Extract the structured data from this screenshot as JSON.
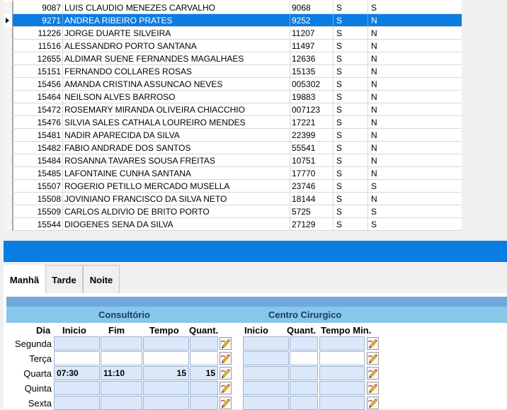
{
  "grid": {
    "rows": [
      {
        "id": "9087",
        "name": "LUIS CLAUDIO MENEZES CARVALHO",
        "code": "9068",
        "s1": "S",
        "s2": "S",
        "selected": false
      },
      {
        "id": "9271",
        "name": "ANDREA RIBEIRO PRATES",
        "code": "9252",
        "s1": "S",
        "s2": "N",
        "selected": true
      },
      {
        "id": "11226",
        "name": "JORGE DUARTE SILVEIRA",
        "code": "11207",
        "s1": "S",
        "s2": "N",
        "selected": false
      },
      {
        "id": "11516",
        "name": "ALESSANDRO PORTO SANTANA",
        "code": "11497",
        "s1": "S",
        "s2": "N",
        "selected": false
      },
      {
        "id": "12655",
        "name": "ALDIMAR SUENE FERNANDES MAGALHAES",
        "code": "12636",
        "s1": "S",
        "s2": "N",
        "selected": false
      },
      {
        "id": "15151",
        "name": "FERNANDO COLLARES ROSAS",
        "code": "15135",
        "s1": "S",
        "s2": "N",
        "selected": false
      },
      {
        "id": "15456",
        "name": "AMANDA CRISTINA ASSUNCAO NEVES",
        "code": "005302",
        "s1": "S",
        "s2": "N",
        "selected": false
      },
      {
        "id": "15464",
        "name": "NEILSON ALVES BARROSO",
        "code": "19883",
        "s1": "S",
        "s2": "N",
        "selected": false
      },
      {
        "id": "15472",
        "name": "ROSEMARY MIRANDA OLIVEIRA CHIACCHIO",
        "code": "007123",
        "s1": "S",
        "s2": "N",
        "selected": false
      },
      {
        "id": "15476",
        "name": "SILVIA SALES CATHALA LOUREIRO MENDES",
        "code": "17221",
        "s1": "S",
        "s2": "N",
        "selected": false
      },
      {
        "id": "15481",
        "name": "NADIR APARECIDA DA SILVA",
        "code": "22399",
        "s1": "S",
        "s2": "N",
        "selected": false
      },
      {
        "id": "15482",
        "name": "FABIO ANDRADE DOS SANTOS",
        "code": "55541",
        "s1": "S",
        "s2": "N",
        "selected": false
      },
      {
        "id": "15484",
        "name": "ROSANNA TAVARES SOUSA FREITAS",
        "code": "10751",
        "s1": "S",
        "s2": "N",
        "selected": false
      },
      {
        "id": "15485",
        "name": "LAFONTAINE CUNHA SANTANA",
        "code": "17770",
        "s1": "S",
        "s2": "N",
        "selected": false
      },
      {
        "id": "15507",
        "name": "ROGERIO PETILLO MERCADO MUSELLA",
        "code": "23746",
        "s1": "S",
        "s2": "S",
        "selected": false
      },
      {
        "id": "15508",
        "name": "JOVINIANO FRANCISCO DA SILVA NETO",
        "code": "18144",
        "s1": "S",
        "s2": "N",
        "selected": false
      },
      {
        "id": "15509",
        "name": "CARLOS ALDIVIO DE BRITO PORTO",
        "code": "5725",
        "s1": "S",
        "s2": "S",
        "selected": false
      },
      {
        "id": "15544",
        "name": "DIOGENES SENA DA SILVA",
        "code": "27129",
        "s1": "S",
        "s2": "S",
        "selected": false
      }
    ]
  },
  "tabs": [
    {
      "label": "Manhã",
      "active": true
    },
    {
      "label": "Tarde",
      "active": false
    },
    {
      "label": "Noite",
      "active": false
    }
  ],
  "schedule": {
    "consultorio_title": "Consultório",
    "centro_title": "Centro Cirurgico",
    "headers": {
      "dia": "Dia",
      "inicio": "Inicio",
      "fim": "Fim",
      "tempo": "Tempo",
      "quant": "Quant.",
      "cc_inicio": "Inicio",
      "cc_quant": "Quant.",
      "cc_tempo_min": "Tempo Min."
    },
    "days": [
      {
        "label": "Segunda",
        "inicio": "",
        "fim": "",
        "tempo": "",
        "quant": "",
        "cc_inicio": "",
        "cc_quant": "",
        "cc_tempo": ""
      },
      {
        "label": "Terça",
        "inicio": "",
        "fim": "",
        "tempo": "",
        "quant": "",
        "cc_inicio": "",
        "cc_quant": "",
        "cc_tempo": ""
      },
      {
        "label": "Quarta",
        "inicio": "07:30",
        "fim": "11:10",
        "tempo": "15",
        "quant": "15",
        "cc_inicio": "",
        "cc_quant": "",
        "cc_tempo": ""
      },
      {
        "label": "Quinta",
        "inicio": "",
        "fim": "",
        "tempo": "",
        "quant": "",
        "cc_inicio": "",
        "cc_quant": "",
        "cc_tempo": ""
      },
      {
        "label": "Sexta",
        "inicio": "",
        "fim": "",
        "tempo": "",
        "quant": "",
        "cc_inicio": "",
        "cc_quant": "",
        "cc_tempo": ""
      }
    ]
  },
  "colors": {
    "selection": "#0a7de3",
    "header_band": "#87c7ea",
    "input_bg": "#dbe8fa"
  },
  "icons": {
    "edit": "pencil-edit-icon",
    "row_indicator": "row-pointer-icon"
  }
}
